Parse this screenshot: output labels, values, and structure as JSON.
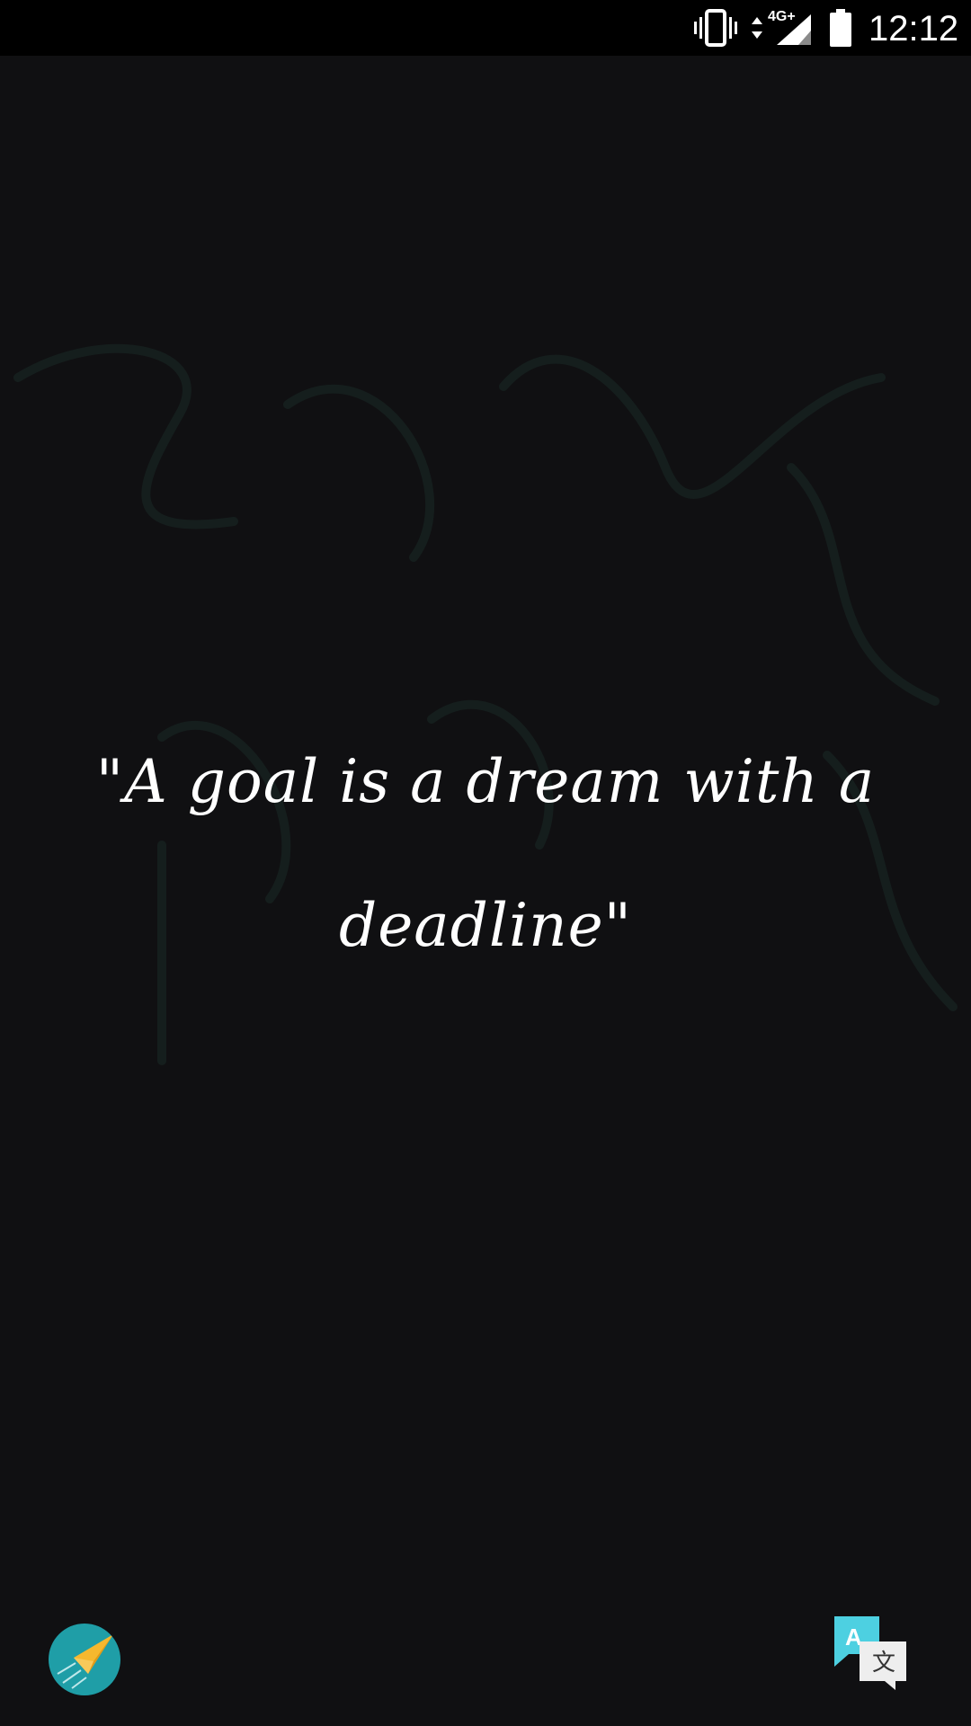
{
  "status_bar": {
    "network_type": "4G+",
    "time": "12:12",
    "icons": [
      "vibrate-icon",
      "data-arrows-icon",
      "signal-icon",
      "battery-icon"
    ]
  },
  "quote": {
    "line1": "\"A goal is a dream with a",
    "line2": "deadline\""
  },
  "actions": {
    "share_icon": "paper-plane-icon",
    "translate_icon": "translate-icon"
  },
  "colors": {
    "background": "#101012",
    "status_bar": "#000000",
    "share_accent": "#1f9ea7",
    "plane": "#f5b82e",
    "translate_bubble": "#4dd0e1"
  }
}
